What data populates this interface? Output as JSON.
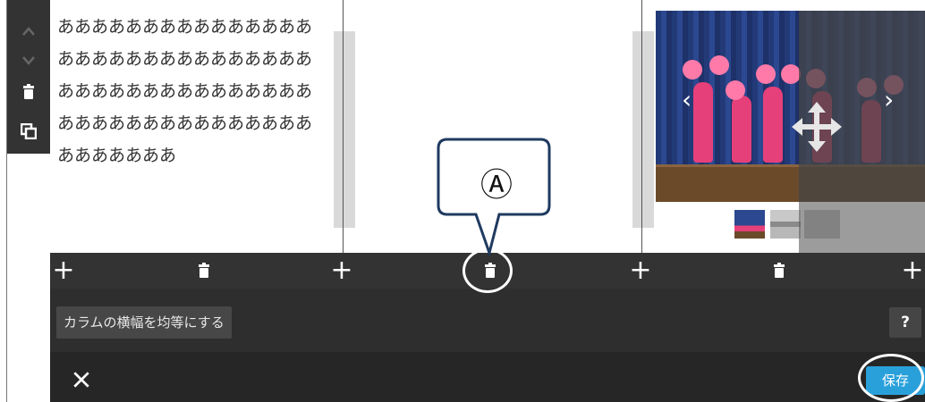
{
  "content": {
    "text": "あああああああああああああああああああああああああああああああああああああああああああああああああああああああああああああああああああ"
  },
  "slider": {
    "prev": "‹",
    "next": "›"
  },
  "options": {
    "equal_width_label": "カラムの横幅を均等にする",
    "help_label": "?"
  },
  "footer": {
    "save_label": "保存"
  },
  "annotation": {
    "label": "Ⓐ"
  },
  "colors": {
    "toolbar": "#333333",
    "save": "#2aa0db",
    "annotation_stroke": "#1f3a60"
  },
  "icons": [
    "chevron-up-icon",
    "chevron-down-icon",
    "trash-icon",
    "duplicate-icon",
    "plus-icon",
    "move-icon",
    "close-icon"
  ]
}
